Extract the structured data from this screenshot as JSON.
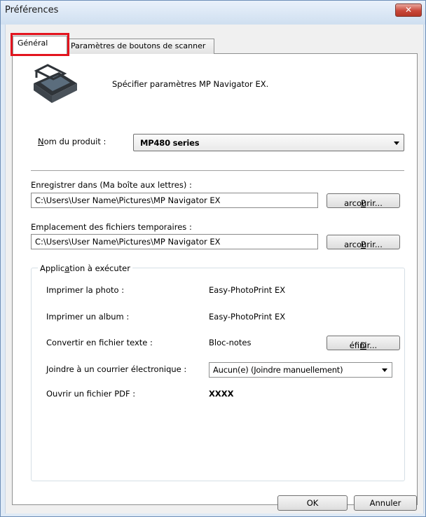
{
  "window": {
    "title": "Préférences",
    "close_glyph": "✕"
  },
  "tabs": [
    {
      "label": "Général",
      "selected": true
    },
    {
      "label": "Paramètres de boutons de scanner",
      "selected": false
    }
  ],
  "header": {
    "icon": "scanner-icon",
    "description": "Spécifier paramètres MP Navigator EX."
  },
  "product": {
    "label_key": "N",
    "label_rest": "om du produit :",
    "value": "MP480 series"
  },
  "save_in": {
    "label": "Enregistrer dans (Ma boîte aux lettres) :",
    "path": "C:\\Users\\User Name\\Pictures\\MP Navigator EX",
    "browse_key": "P",
    "browse_rest": "arcourir..."
  },
  "temp_files": {
    "label": "Emplacement des fichiers temporaires :",
    "path": "C:\\Users\\User Name\\Pictures\\MP Navigator EX",
    "browse_key": "P",
    "browse_rest": "arcourir..."
  },
  "app_group": {
    "title_pre": "Applic",
    "title_key": "a",
    "title_post": "tion à exécuter",
    "rows": [
      {
        "label": "Imprimer la photo :",
        "value": "Easy-PhotoPrint EX"
      },
      {
        "label": "Imprimer un album :",
        "value": "Easy-PhotoPrint EX"
      },
      {
        "label": "Convertir en fichier texte :",
        "value": "Bloc-notes"
      },
      {
        "label": "Joindre à un courrier électronique :",
        "value": "Aucun(e) (Joindre manuellement)"
      },
      {
        "label": "Ouvrir un fichier PDF :",
        "value": "XXXX"
      }
    ],
    "define_key": "D",
    "define_rest": "éfinir..."
  },
  "footer": {
    "ok": "OK",
    "cancel": "Annuler"
  },
  "colors": {
    "highlight": "#e3141e",
    "close_button": "#c9483a"
  }
}
